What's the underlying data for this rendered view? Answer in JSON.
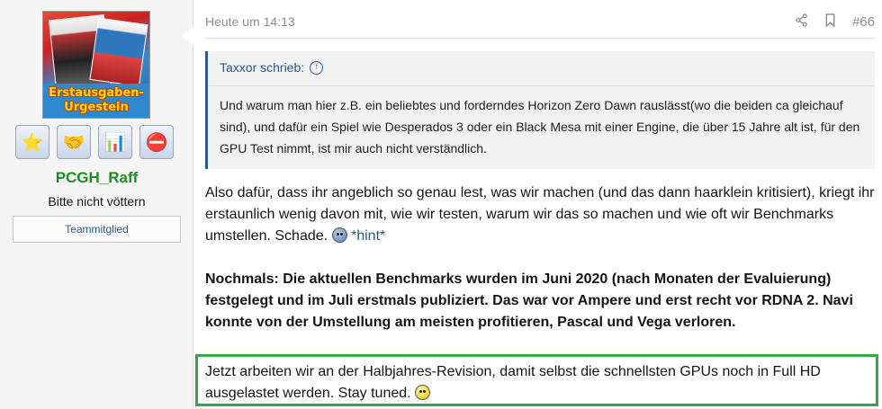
{
  "user": {
    "avatar_text_line1": "Erstausgaben-",
    "avatar_text_line2": "Urgestein",
    "badges": [
      {
        "icon": "star-badge-icon",
        "glyph": "⭐"
      },
      {
        "icon": "handshake-badge-icon",
        "glyph": "🤝"
      },
      {
        "icon": "pcgh-data-badge-icon",
        "glyph": "📊"
      },
      {
        "icon": "no-pdp-badge-icon",
        "glyph": "⛔"
      }
    ],
    "name": "PCGH_Raff",
    "title": "Bitte nicht vöttern",
    "banner": "Teammitglied"
  },
  "post": {
    "date": "Heute um 14:13",
    "number": "#66",
    "share_icon": "share-icon",
    "bookmark_icon": "bookmark-icon"
  },
  "quote": {
    "author": "Taxxor schrieb:",
    "text": "Und warum man hier z.B. ein beliebtes und forderndes Horizon Zero Dawn rauslässt(wo die beiden ca gleichauf sind), und dafür ein Spiel wie Desperados 3 oder ein Black Mesa mit einer Engine, die über 15 Jahre alt ist, für den GPU Test nimmt, ist mir auch nicht verständlich."
  },
  "body": {
    "p1": "Also dafür, dass ihr angeblich so genau lest, was wir machen (und das dann haarklein kritisiert), kriegt ihr erstaunlich wenig davon mit, wie wir testen, warum wir das so machen und wie oft wir Benchmarks umstellen. Schade.",
    "p1_link": "*hint*",
    "p2": "Nochmals: Die aktuellen Benchmarks wurden im Juni 2020 (nach Monaten der Evaluierung) festgelegt und im Juli erstmals publiziert. Das war vor Ampere und erst recht vor RDNA 2. Navi konnte von der Umstellung am meisten profitieren, Pascal und Vega verloren.",
    "p3": "Jetzt arbeiten wir an der Halbjahres-Revision, damit selbst die schnellsten GPUs noch in Full HD ausgelastet werden. Stay tuned."
  },
  "colors": {
    "username": "#1c8e1f",
    "link": "#2c5a8c",
    "highlight_border": "#2ea84a"
  }
}
